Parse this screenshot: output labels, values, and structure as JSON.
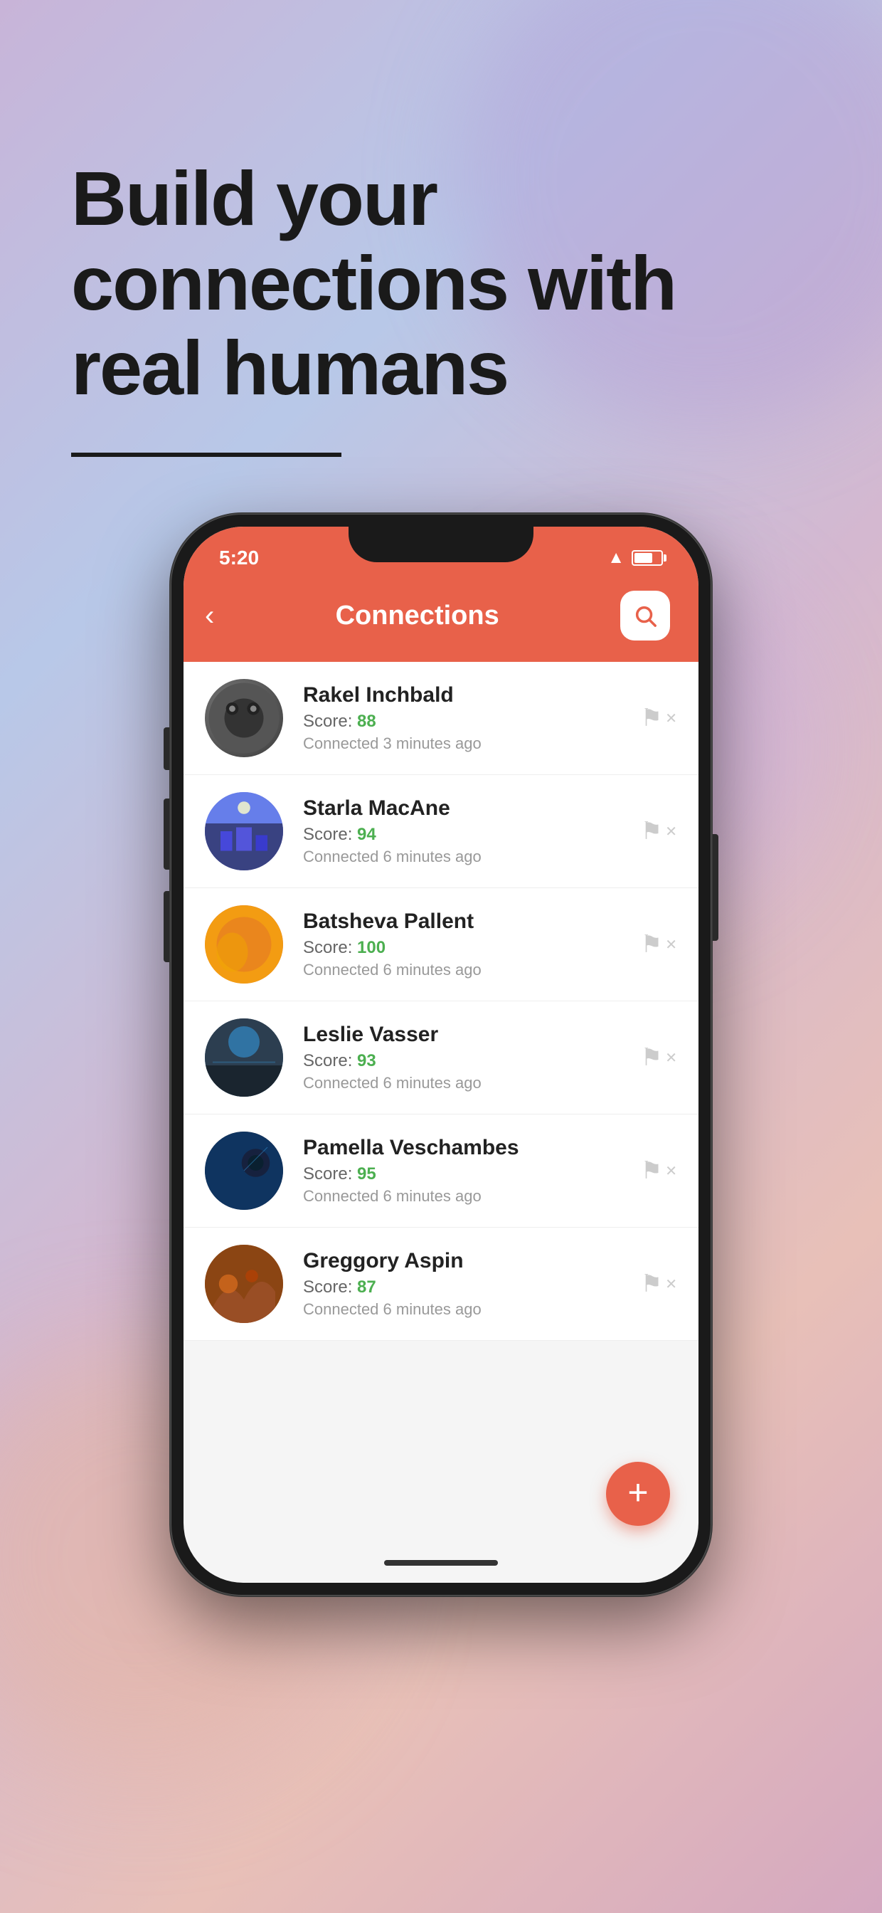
{
  "hero": {
    "title_line1": "Build your",
    "title_line2": "connections with",
    "title_line3": "real humans"
  },
  "app": {
    "status_time": "5:20",
    "header_title": "Connections",
    "back_label": "‹",
    "search_label": "🔍",
    "fab_label": "+",
    "connections": [
      {
        "name": "Rakel Inchbald",
        "score_label": "Score: ",
        "score": "88",
        "time": "Connected 3 minutes ago",
        "avatar_type": "rakel"
      },
      {
        "name": "Starla MacAne",
        "score_label": "Score: ",
        "score": "94",
        "time": "Connected 6 minutes ago",
        "avatar_type": "starla"
      },
      {
        "name": "Batsheva Pallent",
        "score_label": "Score: ",
        "score": "100",
        "time": "Connected 6 minutes ago",
        "avatar_type": "batsheva"
      },
      {
        "name": "Leslie Vasser",
        "score_label": "Score: ",
        "score": "93",
        "time": "Connected 6 minutes ago",
        "avatar_type": "leslie"
      },
      {
        "name": "Pamella Veschambes",
        "score_label": "Score: ",
        "score": "95",
        "time": "Connected 6 minutes ago",
        "avatar_type": "pamella"
      },
      {
        "name": "Greggory Aspin",
        "score_label": "Score: ",
        "score": "87",
        "time": "Connected 6 minutes ago",
        "avatar_type": "greggory"
      }
    ]
  },
  "colors": {
    "header_bg": "#e8614a",
    "fab_bg": "#e8614a",
    "score_color": "#4caf50",
    "text_dark": "#1a1a1a"
  }
}
